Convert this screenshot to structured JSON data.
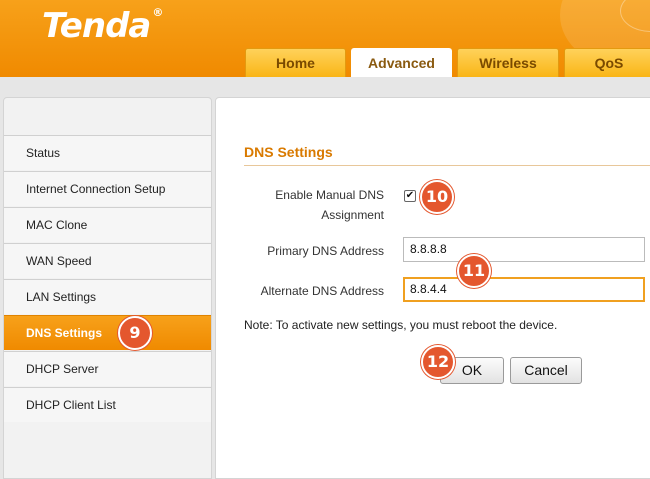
{
  "header": {
    "logo": "Tenda",
    "logo_mark": "®",
    "tabs": [
      {
        "label": "Home"
      },
      {
        "label": "Advanced"
      },
      {
        "label": "Wireless"
      },
      {
        "label": "QoS"
      }
    ],
    "active_tab": "Advanced"
  },
  "sidebar": {
    "items": [
      {
        "label": "Status"
      },
      {
        "label": "Internet Connection Setup"
      },
      {
        "label": "MAC Clone"
      },
      {
        "label": "WAN Speed"
      },
      {
        "label": "LAN Settings"
      },
      {
        "label": "DNS Settings"
      },
      {
        "label": "DHCP Server"
      },
      {
        "label": "DHCP Client List"
      }
    ],
    "active_item": "DNS Settings"
  },
  "main": {
    "title": "DNS Settings",
    "manual_dns_label": "Enable Manual DNS Assignment",
    "manual_dns_checked": true,
    "manual_dns_check_glyph": "✔",
    "primary_label": "Primary DNS Address",
    "primary_value": "8.8.8.8",
    "alternate_label": "Alternate DNS Address",
    "alternate_value": "8.8.4.4",
    "note": "Note: To activate new settings, you must reboot the device.",
    "ok_label": "OK",
    "cancel_label": "Cancel"
  },
  "callouts": {
    "step_9": "9",
    "step_10": "10",
    "step_11": "11",
    "step_12": "12"
  },
  "colors": {
    "brand_orange": "#f08a00",
    "tab_yellow": "#f9b516",
    "title_orange": "#d97a00",
    "callout_red": "#e4572e",
    "focus_border": "#f0a020"
  }
}
